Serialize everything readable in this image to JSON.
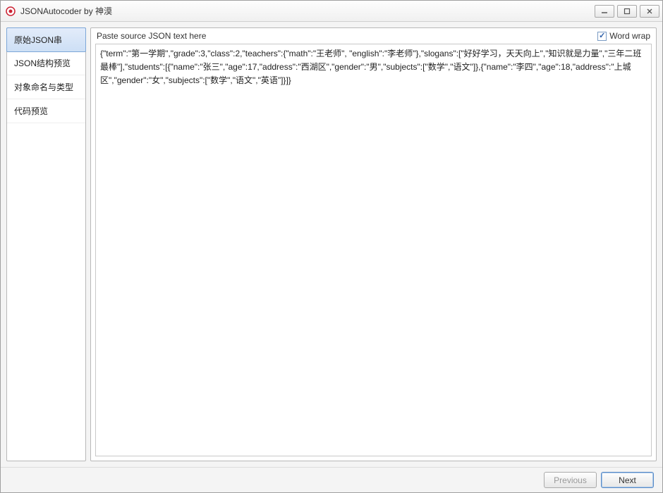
{
  "window": {
    "title": "JSONAutocoder by 神漠"
  },
  "sidebar": {
    "items": [
      {
        "label": "原始JSON串"
      },
      {
        "label": "JSON结构预览"
      },
      {
        "label": "对象命名与类型"
      },
      {
        "label": "代码预览"
      }
    ]
  },
  "main": {
    "header_label": "Paste source JSON text here",
    "word_wrap_label": "Word wrap",
    "word_wrap_checked": true,
    "textarea_value": "{\"term\":\"第一学期\",\"grade\":3,\"class\":2,\"teachers\":{\"math\":\"王老师\", \"english\":\"李老师\"},\"slogans\":[\"好好学习，天天向上\",\"知识就是力量\",\"三年二班最棒\"],\"students\":[{\"name\":\"张三\",\"age\":17,\"address\":\"西湖区\",\"gender\":\"男\",\"subjects\":[\"数学\",\"语文\"]},{\"name\":\"李四\",\"age\":18,\"address\":\"上城区\",\"gender\":\"女\",\"subjects\":[\"数学\",\"语文\",\"英语\"]}]}"
  },
  "footer": {
    "previous_label": "Previous",
    "next_label": "Next"
  }
}
